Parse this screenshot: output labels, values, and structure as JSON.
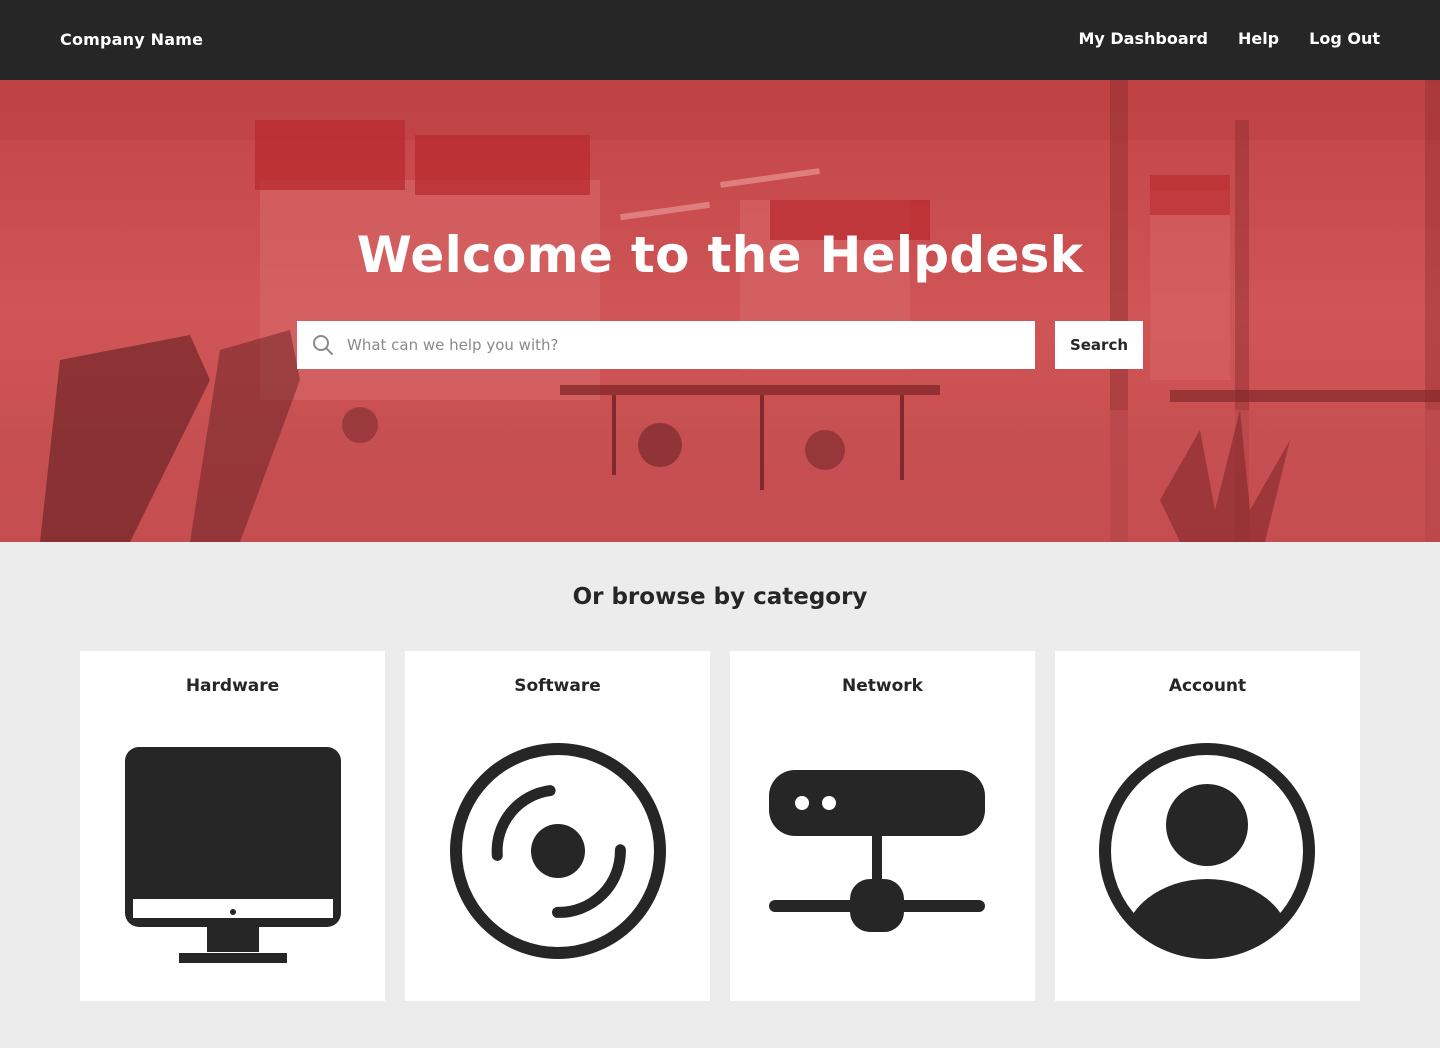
{
  "header": {
    "brand": "Company Name",
    "nav": [
      {
        "label": "My Dashboard"
      },
      {
        "label": "Help"
      },
      {
        "label": "Log Out"
      }
    ]
  },
  "hero": {
    "title": "Welcome to the Helpdesk",
    "overlay_color": "#c94a4c",
    "search": {
      "placeholder": "What can we help you with?",
      "value": "",
      "icon": "search-icon",
      "button_label": "Search"
    }
  },
  "categories": {
    "title": "Or browse by category",
    "items": [
      {
        "label": "Hardware",
        "icon": "monitor-icon"
      },
      {
        "label": "Software",
        "icon": "disc-icon"
      },
      {
        "label": "Network",
        "icon": "server-network-icon"
      },
      {
        "label": "Account",
        "icon": "user-circle-icon"
      }
    ]
  },
  "colors": {
    "topbar": "#262626",
    "page_background": "#ececec",
    "card_background": "#ffffff",
    "icon": "#262626"
  }
}
